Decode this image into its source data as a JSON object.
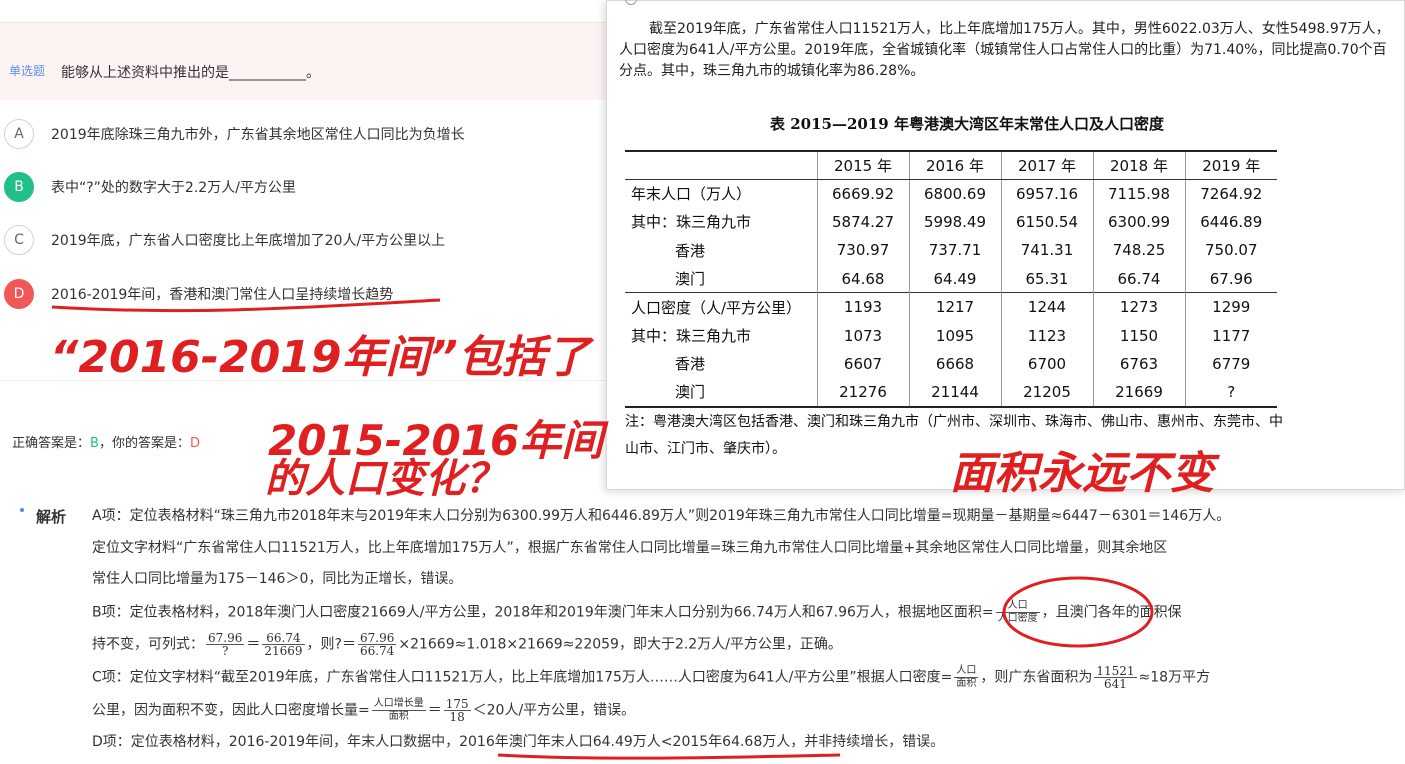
{
  "question": {
    "type_label": "单选题",
    "text": "能够从上述资料中推出的是___________。",
    "options": [
      {
        "letter": "A",
        "text": "2019年底除珠三角九市外，广东省其余地区常住人口同比为负增长",
        "state": "normal"
      },
      {
        "letter": "B",
        "text": "表中“?”处的数字大于2.2万人/平方公里",
        "state": "correct"
      },
      {
        "letter": "C",
        "text": "2019年底，广东省人口密度比上年底增加了20人/平方公里以上",
        "state": "normal"
      },
      {
        "letter": "D",
        "text": "2016-2019年间，香港和澳门常住人口呈持续增长趋势",
        "state": "wrong"
      }
    ]
  },
  "answer": {
    "prefix": "正确答案是：",
    "correct": "B",
    "middle": "，你的答案是：",
    "yours": "D"
  },
  "analysis": {
    "label": "解析",
    "lines": [
      "A项：定位表格材料“珠三角九市2018年末与2019年末人口分别为6300.99万人和6446.89万人”则2019年珠三角九市常住人口同比增量=现期量－基期量≈6447－6301＝146万人。",
      "定位文字材料“广东省常住人口11521万人，比上年底增加175万人”，根据广东省常住人口同比增量=珠三角九市常住人口同比增量+其余地区常住人口同比增量，则其余地区",
      "常住人口同比增量为175－146＞0，同比为正增长，错误。",
      "B项：定位表格材料，2018年澳门人口密度21669人/平方公里，2018年和2019年澳门年末人口分别为66.74万人和67.96万人，根据地区面积=",
      "，且澳门各年的面积保",
      "持不变，可列式：",
      "，则?＝",
      "×21669≈1.018×21669≈22059，即大于2.2万人/平方公里，正确。",
      "C项：定位文字材料“截至2019年底，广东省常住人口11521万人，比上年底增加175万人……人口密度为641人/平方公里”根据人口密度=",
      "，则广东省面积为",
      "≈18万平方",
      "公里，因为面积不变，因此人口密度增长量=",
      "＝",
      "＜20人/平方公里，错误。",
      "D项：定位表格材料，2016-2019年间，年末人口数据中，",
      "2016年澳门年末人口64.49万人<2015年64.68万人",
      "，并非持续增长，错误。"
    ],
    "fractions": {
      "area": {
        "num": "人口",
        "den": "人口密度"
      },
      "b1": {
        "num": "67.96",
        "den": "?"
      },
      "b2": {
        "num": "66.74",
        "den": "21669"
      },
      "b3": {
        "num": "67.96",
        "den": "66.74"
      },
      "density": {
        "num": "人口",
        "den": "面积"
      },
      "c_area": {
        "num": "11521",
        "den": "641"
      },
      "growth": {
        "num": "人口增长量",
        "den": "面积"
      },
      "c_val": {
        "num": "175",
        "den": "18"
      }
    }
  },
  "material": {
    "paragraph": "截至2019年底，广东省常住人口11521万人，比上年底增加175万人。其中，男性6022.03万人、女性5498.97万人，人口密度为641人/平方公里。2019年底，全省城镇化率（城镇常住人口占常住人口的比重）为71.40%，同比提高0.70个百分点。其中，珠三角九市的城镇化率为86.28%。",
    "table_title": "表  2015—2019 年粤港澳大湾区年末常住人口及人口密度",
    "columns": [
      "2015 年",
      "2016 年",
      "2017 年",
      "2018 年",
      "2019 年"
    ],
    "rows": [
      {
        "label": "年末人口（万人）",
        "values": [
          "6669.92",
          "6800.69",
          "6957.16",
          "7115.98",
          "7264.92"
        ]
      },
      {
        "label": "其中：珠三角九市",
        "values": [
          "5874.27",
          "5998.49",
          "6150.54",
          "6300.99",
          "6446.89"
        ]
      },
      {
        "label": "香港",
        "values": [
          "730.97",
          "737.71",
          "741.31",
          "748.25",
          "750.07"
        ]
      },
      {
        "label": "澳门",
        "values": [
          "64.68",
          "64.49",
          "65.31",
          "66.74",
          "67.96"
        ]
      },
      {
        "label": "人口密度（人/平方公里）",
        "values": [
          "1193",
          "1217",
          "1244",
          "1273",
          "1299"
        ]
      },
      {
        "label": "其中：珠三角九市",
        "values": [
          "1073",
          "1095",
          "1123",
          "1150",
          "1177"
        ]
      },
      {
        "label": "香港",
        "values": [
          "6607",
          "6668",
          "6700",
          "6763",
          "6779"
        ]
      },
      {
        "label": "澳门",
        "values": [
          "21276",
          "21144",
          "21205",
          "21669",
          "?"
        ]
      }
    ],
    "note": "注：粤港澳大湾区包括香港、澳门和珠三角九市（广州市、深圳市、珠海市、佛山市、惠州市、东莞市、中山市、江门市、肇庆市）。"
  },
  "handwriting": {
    "note1": "“2016-2019年间”包括了",
    "note2a": "2015-2016年间",
    "note2b": "的人口变化？",
    "note3": "面积永远不变"
  },
  "colors": {
    "accent": "#4a8af4",
    "correct": "#21c08b",
    "wrong": "#f25757",
    "ink": "#e02020"
  }
}
